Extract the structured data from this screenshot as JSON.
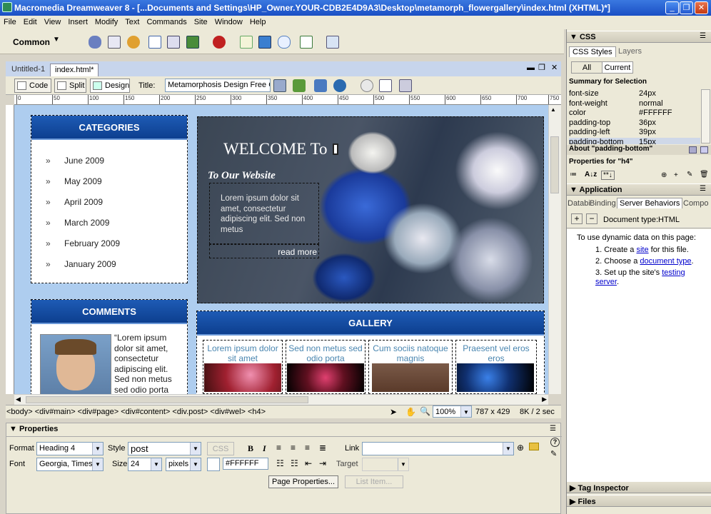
{
  "window": {
    "title": "Macromedia Dreamweaver 8 - [...Documents and Settings\\HP_Owner.YOUR-CDB2E4D9A3\\Desktop\\metamorph_flowergallery\\index.html (XHTML)*]",
    "minimize": "_",
    "maximize": "❐",
    "close": "✕"
  },
  "menu": [
    "File",
    "Edit",
    "View",
    "Insert",
    "Modify",
    "Text",
    "Commands",
    "Site",
    "Window",
    "Help"
  ],
  "insert_bar": {
    "category": "Common"
  },
  "doc_tabs": [
    {
      "label": "Untitled-1"
    },
    {
      "label": "index.html*"
    }
  ],
  "doc_toolbar": {
    "code_label": "Code",
    "split_label": "Split",
    "design_label": "Design",
    "title_label": "Title:",
    "title_value": "Metamorphosis Design Free Cs"
  },
  "ruler": [
    "0",
    "50",
    "100",
    "150",
    "200",
    "250",
    "300",
    "350",
    "400",
    "450",
    "500",
    "550",
    "600",
    "650",
    "700",
    "750"
  ],
  "page": {
    "categories": {
      "heading": "CATEGORIES",
      "bullet": "»",
      "items": [
        "June 2009",
        "May 2009",
        "April 2009",
        "March 2009",
        "February 2009",
        "January 2009"
      ]
    },
    "comments": {
      "heading": "COMMENTS",
      "text": "“Lorem ipsum dolor sit amet, consectetur adipiscing elit. Sed non metus sed odio porta"
    },
    "hero": {
      "welcome": "WELCOME To",
      "subtitle": "To Our Website",
      "body": "Lorem ipsum dolor sit amet, consectetur adipiscing elit. Sed non metus",
      "read_more": "read more"
    },
    "gallery": {
      "heading": "GALLERY",
      "captions": [
        "Lorem ipsum dolor sit amet",
        "Sed non metus sed odio porta",
        "Cum sociis natoque magnis",
        "Praesent vel eros eros"
      ]
    }
  },
  "statusbar": {
    "tags": "<body> <div#main> <div#page> <div#content> <div.post> <div#wel> <h4>",
    "zoom": "100%",
    "dimensions": "787 x 429",
    "size": "8K / 2 sec"
  },
  "properties": {
    "title": "Properties",
    "format_label": "Format",
    "format_value": "Heading 4",
    "style_label": "Style",
    "style_value": "post",
    "css_button": "CSS",
    "bold": "B",
    "italic": "I",
    "link_label": "Link",
    "link_value": "",
    "font_label": "Font",
    "font_value": "Georgia, Times",
    "size_label": "Size",
    "size_value": "24",
    "unit_value": "pixels",
    "color_value": "#FFFFFF",
    "target_label": "Target",
    "target_value": "",
    "page_properties": "Page Properties...",
    "list_item": "List Item..."
  },
  "css_panel": {
    "title": "CSS",
    "tabs": [
      "CSS Styles",
      "Layers"
    ],
    "modes": [
      "All",
      "Current"
    ],
    "summary_title": "Summary for Selection",
    "rules": [
      {
        "k": "font-size",
        "v": "24px"
      },
      {
        "k": "font-weight",
        "v": "normal"
      },
      {
        "k": "color",
        "v": "#FFFFFF"
      },
      {
        "k": "padding-top",
        "v": "36px"
      },
      {
        "k": "padding-left",
        "v": "39px"
      },
      {
        "k": "padding-bottom",
        "v": "15px"
      }
    ],
    "about": "About \"padding-bottom\"",
    "properties_for": "Properties for \"h4\""
  },
  "app_panel": {
    "title": "Application",
    "tabs": [
      "Databi",
      "Binding",
      "Server Behaviors",
      "Compo"
    ],
    "doc_type": "Document type:HTML",
    "intro": "To use dynamic data on this page:",
    "steps": [
      {
        "pre": "Create a ",
        "link": "site",
        "post": " for this file."
      },
      {
        "pre": "Choose a ",
        "link": "document type",
        "post": "."
      },
      {
        "pre": "Set up the site's ",
        "link": "testing server",
        "post": "."
      }
    ]
  },
  "bottom_panels": [
    "Tag Inspector",
    "Files"
  ],
  "colors": {
    "title_blue": "#1a4fc4",
    "page_bg": "#aecdef",
    "header_blue": "#0d3f8f"
  }
}
